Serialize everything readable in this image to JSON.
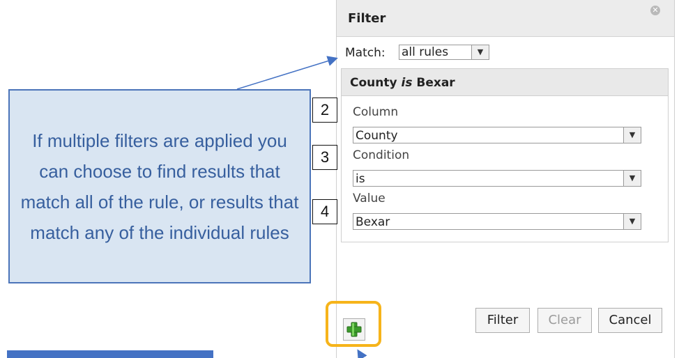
{
  "dialog": {
    "title": "Filter",
    "close_icon": "close-icon",
    "match_label": "Match:",
    "match_value": "all rules",
    "rule": {
      "title_prefix": "County ",
      "title_operator": "is",
      "title_suffix": " Bexar",
      "fields": [
        {
          "label": "Column",
          "value": "County"
        },
        {
          "label": "Condition",
          "value": "is"
        },
        {
          "label": "Value",
          "value": "Bexar"
        }
      ]
    },
    "buttons": {
      "filter": "Filter",
      "clear": "Clear",
      "cancel": "Cancel",
      "add_rule_icon": "plus-icon"
    }
  },
  "annotations": {
    "callout_text": "If multiple filters are applied you can choose to find results that match all of the rule, or results that match any of the individual rules",
    "step_numbers": [
      "2",
      "3",
      "4"
    ],
    "highlight_color": "#f6b41b",
    "callout_color": "#4b74b9"
  }
}
